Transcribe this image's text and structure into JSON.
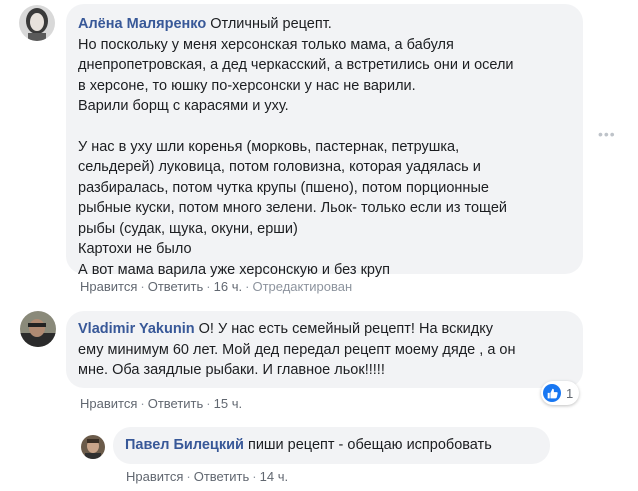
{
  "comments": [
    {
      "author": "Алёна Маляренко",
      "text_lines": [
        "Отличный рецепт.",
        "Но поскольку у меня херсонская только мама, а бабуля",
        "днепропетровская, а дед черкасский, а встретились они и осели",
        "в херсоне, то юшку по-херсонски у нас не варили.",
        "Варили борщ с карасями и уху.",
        "",
        "У нас в уху шли коренья (морковь, пастернак, петрушка,",
        "сельдерей) луковица, потом головизна, которая уадялась и",
        "разбиралась, потом чутка крупы (пшено), потом порционные",
        "рыбные куски, потом много зелени. Льок- только если из тощей",
        "рыбы (судак, щука, окуни, ерши)",
        "Картохи не было",
        "А вот мама варила уже херсонскую и без круп"
      ],
      "like_label": "Нравится",
      "reply_label": "Ответить",
      "time": "16 ч.",
      "edited": "Отредактирован"
    },
    {
      "author": "Vladimir Yakunin",
      "text_lines": [
        "О! У нас есть семейный рецепт! На вскидку",
        "ему минимум 60 лет. Мой дед передал рецепт моему дяде , а он",
        "мне. Оба заядлые рыбаки. И главное льок!!!!!"
      ],
      "like_label": "Нравится",
      "reply_label": "Ответить",
      "time": "15 ч.",
      "reaction_count": "1"
    },
    {
      "author": "Павел Билецкий",
      "text": "пиши рецепт - обещаю испробовать",
      "like_label": "Нравится",
      "reply_label": "Ответить",
      "time": "14 ч."
    }
  ],
  "icons": {
    "more": "more-dots-icon",
    "like": "thumbs-up-icon"
  },
  "colors": {
    "author": "#385898",
    "bubble": "#f2f3f5",
    "like_badge": "#1877f2",
    "meta": "#8d949e"
  }
}
